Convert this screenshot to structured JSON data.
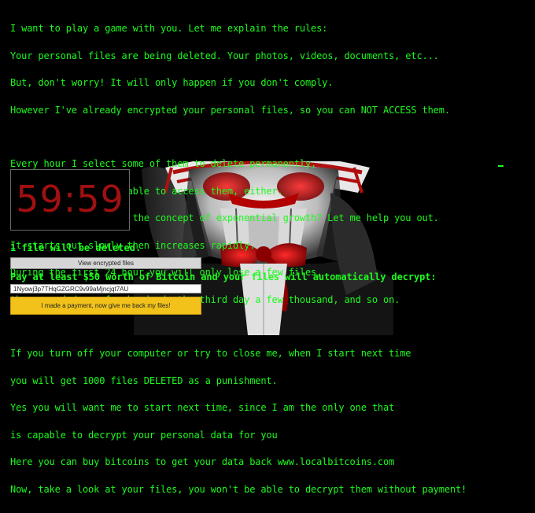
{
  "message": {
    "paragraph1": [
      "I want to play a game with you. Let me explain the rules:",
      "Your personal files are being deleted. Your photos, videos, documents, etc...",
      "But, don't worry! It will only happen if you don't comply.",
      "However I've already encrypted your personal files, so you can NOT ACCESS them."
    ],
    "paragraph2": [
      "Every hour I select some of them to delete permanently,",
      "therefore I won't be able to access them, either.",
      "Are you familiar with the concept of exponential growth? Let me help you out.",
      "It starts out slowly then increases rapidly.",
      "During the first 24 hour you will only lose a few files,",
      "the second day a few hundred, the third day a few thousand, and so on."
    ],
    "paragraph3": [
      "If you turn off your computer or try to close me, when I start next time",
      "you will get 1000 files DELETED as a punishment.",
      "Yes you will want me to start next time, since I am the only one that",
      "is capable to decrypt your personal data for you",
      "Here you can buy bitcoins to get your data back www.localbitcoins.com",
      "Now, take a look at your files, you won't be able to decrypt them without payment!"
    ]
  },
  "timer": {
    "value": "59:59",
    "color": "#a01010"
  },
  "status": {
    "files_deleted": "1 file will be deleted."
  },
  "buttons": {
    "view_encrypted": "View encrypted files",
    "paid": "I made a payment, now give me back my files!"
  },
  "payment": {
    "instruction": "Pay at least $50 worth of Bitcoin and your files will automatically decrypt:",
    "bitcoin_address": "1Nyowj3p7THqGZGRC9v99aMjncjqt7AU"
  },
  "colors": {
    "text": "#1dfa1d",
    "background": "#000000",
    "paid_button": "#f2c21a"
  }
}
